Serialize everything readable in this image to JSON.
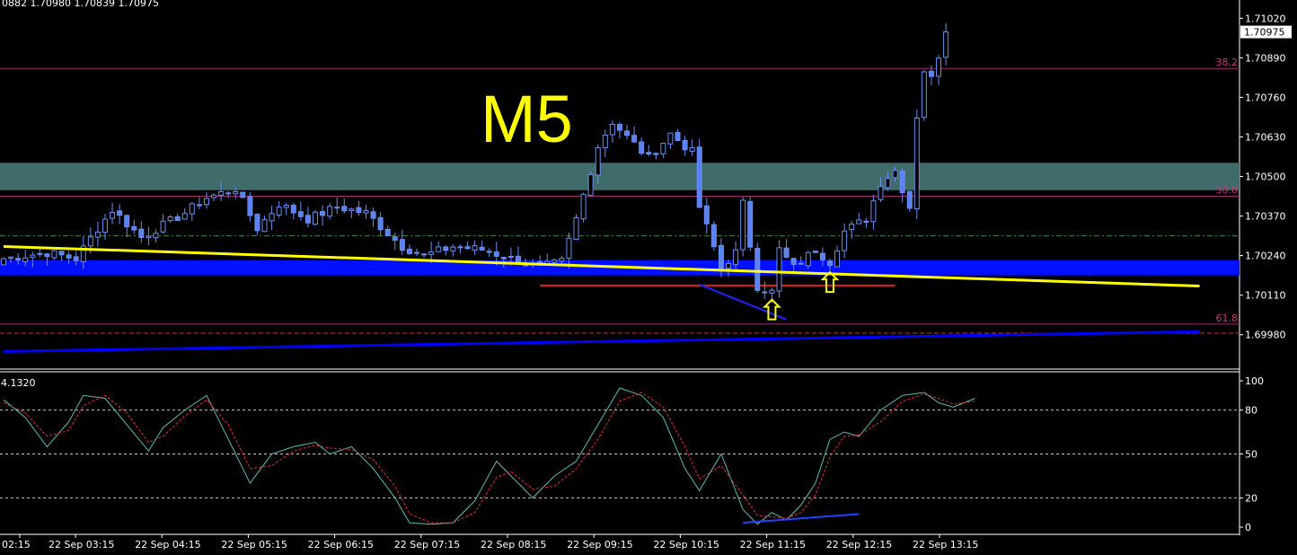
{
  "chart_data": [
    {
      "type": "candlestick",
      "header_ohlc": "0882 1.70980 1.70839 1.70975",
      "timeframe_label": "M5",
      "current_price": "1.70975",
      "ylim": [
        1.6987,
        1.7108
      ],
      "y_ticks": [
        "1.71020",
        "1.70890",
        "1.70760",
        "1.70630",
        "1.70500",
        "1.70370",
        "1.70240",
        "1.70110",
        "1.69980"
      ],
      "x_ticks": [
        "02:15",
        "22 Sep 03:15",
        "22 Sep 04:15",
        "22 Sep 05:15",
        "22 Sep 06:15",
        "22 Sep 07:15",
        "22 Sep 08:15",
        "22 Sep 09:15",
        "22 Sep 10:15",
        "22 Sep 11:15",
        "22 Sep 12:15",
        "22 Sep 13:15"
      ],
      "fib_levels": [
        {
          "label": "38.2",
          "price": 1.70855
        },
        {
          "label": "50.0",
          "price": 1.70435
        },
        {
          "label": "61.8",
          "price": 1.70015
        }
      ],
      "supply_zone": [
        1.70455,
        1.70545
      ],
      "demand_zone": [
        1.70175,
        1.70225
      ],
      "horizontal_lines": [
        {
          "price": 1.70305,
          "style": "dash-dot",
          "color": "#3b8a3b"
        },
        {
          "price": 1.69985,
          "style": "dash",
          "color": "#c0392b"
        },
        {
          "price": 1.70142,
          "style": "solid",
          "color": "#e02020",
          "from_bar": 74,
          "to_bar": 123
        }
      ],
      "trend_lines": [
        {
          "color": "#ffff00",
          "bar1": 0,
          "price1": 1.7027,
          "bar2": 165,
          "price2": 1.7014
        },
        {
          "color": "#0000ff",
          "bar1": 0,
          "price1": 1.69925,
          "bar2": 165,
          "price2": 1.6999
        },
        {
          "color": "#2222ff",
          "bar1": 96,
          "price1": 1.70145,
          "bar2": 108,
          "price2": 1.7003
        }
      ],
      "arrows": [
        {
          "bar": 106,
          "price": 1.7006,
          "color": "#ffff00"
        },
        {
          "bar": 114,
          "price": 1.7015,
          "color": "#ffff00"
        }
      ],
      "anchors": [
        {
          "bar": 0,
          "close": 1.7023
        },
        {
          "bar": 6,
          "close": 1.7025
        },
        {
          "bar": 10,
          "close": 1.7023
        },
        {
          "bar": 13,
          "close": 1.7033
        },
        {
          "bar": 15,
          "close": 1.7039
        },
        {
          "bar": 19,
          "close": 1.703
        },
        {
          "bar": 25,
          "close": 1.7038
        },
        {
          "bar": 28,
          "close": 1.7043
        },
        {
          "bar": 32,
          "close": 1.7046
        },
        {
          "bar": 35,
          "close": 1.7033
        },
        {
          "bar": 38,
          "close": 1.7041
        },
        {
          "bar": 42,
          "close": 1.7036
        },
        {
          "bar": 46,
          "close": 1.704
        },
        {
          "bar": 50,
          "close": 1.7038
        },
        {
          "bar": 55,
          "close": 1.7027
        },
        {
          "bar": 58,
          "close": 1.7024
        },
        {
          "bar": 62,
          "close": 1.7027
        },
        {
          "bar": 66,
          "close": 1.7026
        },
        {
          "bar": 70,
          "close": 1.7023
        },
        {
          "bar": 74,
          "close": 1.702
        },
        {
          "bar": 77,
          "close": 1.7022
        },
        {
          "bar": 79,
          "close": 1.7036
        },
        {
          "bar": 82,
          "close": 1.706
        },
        {
          "bar": 84,
          "close": 1.7068
        },
        {
          "bar": 86,
          "close": 1.7063
        },
        {
          "bar": 89,
          "close": 1.7056
        },
        {
          "bar": 92,
          "close": 1.7064
        },
        {
          "bar": 95,
          "close": 1.7058
        },
        {
          "bar": 96,
          "close": 1.704
        },
        {
          "bar": 99,
          "close": 1.702
        },
        {
          "bar": 101,
          "close": 1.7025
        },
        {
          "bar": 102,
          "close": 1.7041
        },
        {
          "bar": 104,
          "close": 1.7014
        },
        {
          "bar": 106,
          "close": 1.7012
        },
        {
          "bar": 107,
          "close": 1.7026
        },
        {
          "bar": 109,
          "close": 1.702
        },
        {
          "bar": 112,
          "close": 1.7026
        },
        {
          "bar": 114,
          "close": 1.7022
        },
        {
          "bar": 116,
          "close": 1.7032
        },
        {
          "bar": 119,
          "close": 1.7036
        },
        {
          "bar": 121,
          "close": 1.7048
        },
        {
          "bar": 123,
          "close": 1.7052
        },
        {
          "bar": 125,
          "close": 1.704
        },
        {
          "bar": 126,
          "close": 1.707
        },
        {
          "bar": 127,
          "close": 1.7085
        },
        {
          "bar": 128,
          "close": 1.7082
        },
        {
          "bar": 129,
          "close": 1.709
        },
        {
          "bar": 130,
          "close": 1.70975
        }
      ]
    },
    {
      "type": "line",
      "indicator_value": "4.1320",
      "ylim": [
        0,
        100
      ],
      "y_ticks": [
        "100",
        "80",
        "50",
        "20",
        "0"
      ],
      "levels": [
        80,
        50,
        20
      ],
      "series": [
        {
          "color": "#5fbcb6",
          "style": "solid",
          "values": [
            {
              "bar": 0,
              "value": 87
            },
            {
              "bar": 3,
              "value": 75
            },
            {
              "bar": 6,
              "value": 55
            },
            {
              "bar": 9,
              "value": 72
            },
            {
              "bar": 11,
              "value": 90
            },
            {
              "bar": 14,
              "value": 88
            },
            {
              "bar": 17,
              "value": 70
            },
            {
              "bar": 20,
              "value": 52
            },
            {
              "bar": 22,
              "value": 68
            },
            {
              "bar": 25,
              "value": 80
            },
            {
              "bar": 28,
              "value": 90
            },
            {
              "bar": 31,
              "value": 60
            },
            {
              "bar": 34,
              "value": 30
            },
            {
              "bar": 37,
              "value": 50
            },
            {
              "bar": 40,
              "value": 55
            },
            {
              "bar": 43,
              "value": 58
            },
            {
              "bar": 45,
              "value": 50
            },
            {
              "bar": 48,
              "value": 55
            },
            {
              "bar": 51,
              "value": 40
            },
            {
              "bar": 54,
              "value": 20
            },
            {
              "bar": 56,
              "value": 3
            },
            {
              "bar": 59,
              "value": 2
            },
            {
              "bar": 62,
              "value": 3
            },
            {
              "bar": 65,
              "value": 18
            },
            {
              "bar": 68,
              "value": 45
            },
            {
              "bar": 70,
              "value": 35
            },
            {
              "bar": 73,
              "value": 20
            },
            {
              "bar": 76,
              "value": 35
            },
            {
              "bar": 79,
              "value": 45
            },
            {
              "bar": 82,
              "value": 70
            },
            {
              "bar": 85,
              "value": 95
            },
            {
              "bar": 88,
              "value": 90
            },
            {
              "bar": 91,
              "value": 75
            },
            {
              "bar": 94,
              "value": 40
            },
            {
              "bar": 96,
              "value": 25
            },
            {
              "bar": 99,
              "value": 50
            },
            {
              "bar": 102,
              "value": 12
            },
            {
              "bar": 104,
              "value": 2
            },
            {
              "bar": 106,
              "value": 10
            },
            {
              "bar": 108,
              "value": 5
            },
            {
              "bar": 110,
              "value": 15
            },
            {
              "bar": 112,
              "value": 30
            },
            {
              "bar": 114,
              "value": 60
            },
            {
              "bar": 116,
              "value": 65
            },
            {
              "bar": 118,
              "value": 62
            },
            {
              "bar": 121,
              "value": 80
            },
            {
              "bar": 124,
              "value": 90
            },
            {
              "bar": 127,
              "value": 92
            },
            {
              "bar": 129,
              "value": 85
            },
            {
              "bar": 131,
              "value": 82
            },
            {
              "bar": 134,
              "value": 88
            }
          ]
        },
        {
          "color": "#e03030",
          "style": "dash",
          "values": [
            {
              "bar": 0,
              "value": 85
            },
            {
              "bar": 3,
              "value": 78
            },
            {
              "bar": 6,
              "value": 62
            },
            {
              "bar": 9,
              "value": 66
            },
            {
              "bar": 11,
              "value": 83
            },
            {
              "bar": 14,
              "value": 90
            },
            {
              "bar": 17,
              "value": 78
            },
            {
              "bar": 20,
              "value": 58
            },
            {
              "bar": 22,
              "value": 62
            },
            {
              "bar": 25,
              "value": 76
            },
            {
              "bar": 28,
              "value": 87
            },
            {
              "bar": 31,
              "value": 70
            },
            {
              "bar": 34,
              "value": 40
            },
            {
              "bar": 37,
              "value": 42
            },
            {
              "bar": 40,
              "value": 52
            },
            {
              "bar": 43,
              "value": 56
            },
            {
              "bar": 45,
              "value": 54
            },
            {
              "bar": 48,
              "value": 53
            },
            {
              "bar": 51,
              "value": 46
            },
            {
              "bar": 54,
              "value": 28
            },
            {
              "bar": 56,
              "value": 9
            },
            {
              "bar": 59,
              "value": 3
            },
            {
              "bar": 62,
              "value": 3
            },
            {
              "bar": 65,
              "value": 10
            },
            {
              "bar": 68,
              "value": 34
            },
            {
              "bar": 70,
              "value": 38
            },
            {
              "bar": 73,
              "value": 26
            },
            {
              "bar": 76,
              "value": 28
            },
            {
              "bar": 79,
              "value": 40
            },
            {
              "bar": 82,
              "value": 60
            },
            {
              "bar": 85,
              "value": 86
            },
            {
              "bar": 88,
              "value": 92
            },
            {
              "bar": 91,
              "value": 82
            },
            {
              "bar": 94,
              "value": 55
            },
            {
              "bar": 96,
              "value": 33
            },
            {
              "bar": 99,
              "value": 42
            },
            {
              "bar": 102,
              "value": 22
            },
            {
              "bar": 104,
              "value": 8
            },
            {
              "bar": 106,
              "value": 7
            },
            {
              "bar": 108,
              "value": 6
            },
            {
              "bar": 110,
              "value": 10
            },
            {
              "bar": 112,
              "value": 22
            },
            {
              "bar": 114,
              "value": 48
            },
            {
              "bar": 116,
              "value": 62
            },
            {
              "bar": 118,
              "value": 63
            },
            {
              "bar": 121,
              "value": 72
            },
            {
              "bar": 124,
              "value": 86
            },
            {
              "bar": 127,
              "value": 91
            },
            {
              "bar": 129,
              "value": 88
            },
            {
              "bar": 131,
              "value": 84
            },
            {
              "bar": 134,
              "value": 86
            }
          ]
        }
      ],
      "trend_lines": [
        {
          "color": "#2244ff",
          "bar1": 102,
          "value1": 3,
          "bar2": 118,
          "value2": 9
        }
      ]
    }
  ]
}
